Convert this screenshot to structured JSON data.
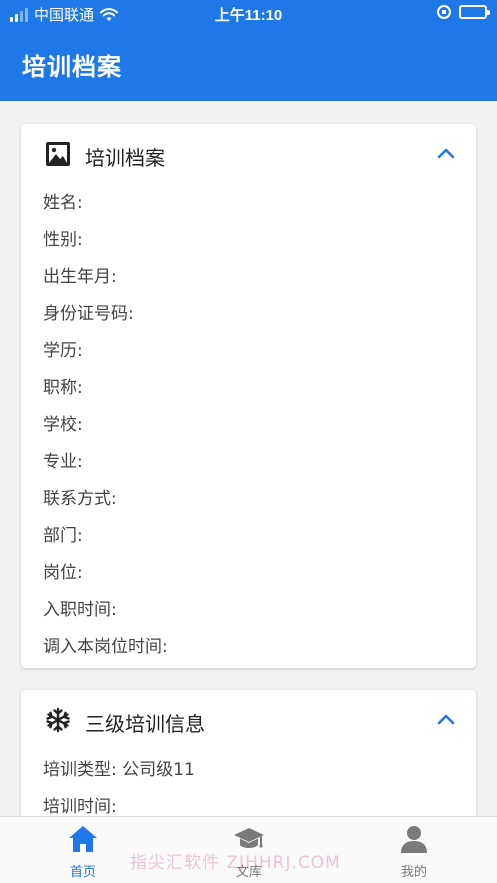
{
  "status_bar": {
    "carrier": "中国联通",
    "time": "上午11:10"
  },
  "header": {
    "title": "培训档案"
  },
  "profile_card": {
    "title": "培训档案",
    "icon": "image-icon",
    "fields": [
      "姓名:",
      "性别:",
      "出生年月:",
      "身份证号码:",
      "学历:",
      "职称:",
      "学校:",
      "专业:",
      "联系方式:",
      "部门:",
      "岗位:",
      "入职时间:",
      "调入本岗位时间:"
    ]
  },
  "training_card": {
    "title": "三级培训信息",
    "icon": "snowflake-icon",
    "fields": [
      "培训类型: 公司级11",
      "培训时间:"
    ]
  },
  "tab_bar": {
    "items": [
      {
        "label": "首页",
        "icon": "home-icon",
        "active": true
      },
      {
        "label": "文库",
        "icon": "graduation-cap-icon",
        "active": false
      },
      {
        "label": "我的",
        "icon": "person-icon",
        "active": false
      }
    ]
  },
  "watermark": "指尖汇软件 ZJHHRJ.COM",
  "colors": {
    "accent": "#1e78e8",
    "background": "#f2f2f2",
    "card": "#ffffff",
    "inactive_tab": "#7a7a7a"
  }
}
